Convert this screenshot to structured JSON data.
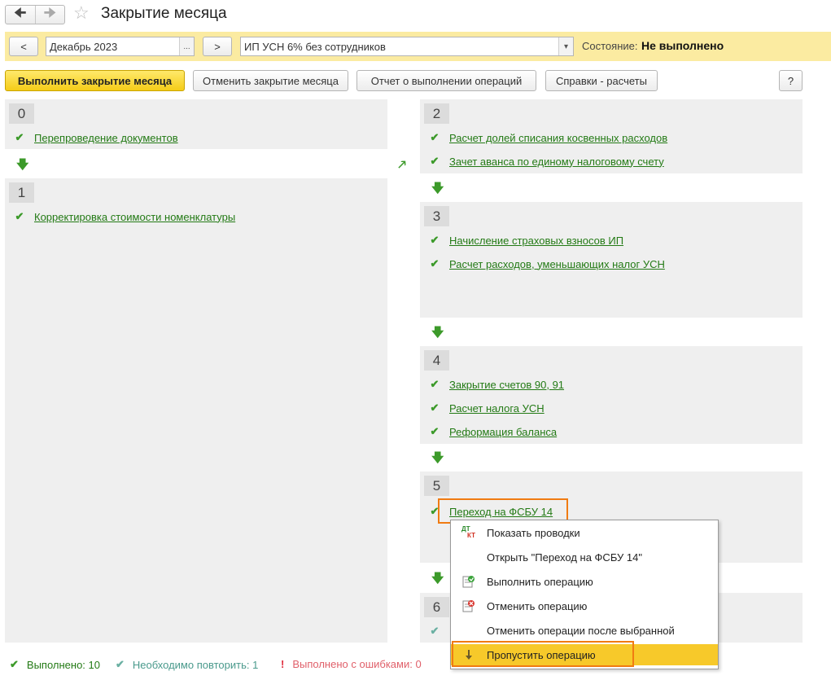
{
  "window": {
    "title": "Закрытие месяца"
  },
  "period": {
    "prev_label": "<",
    "value": "Декабрь 2023",
    "select_label": "...",
    "next_label": ">"
  },
  "organization": {
    "value": "ИП УСН 6% без сотрудников",
    "dropdown_glyph": "▾"
  },
  "state": {
    "label": "Состояние:",
    "value": "Не выполнено"
  },
  "toolbar": {
    "execute": "Выполнить закрытие месяца",
    "cancel": "Отменить закрытие месяца",
    "report": "Отчет о выполнении операций",
    "calculations": "Справки - расчеты",
    "help": "?"
  },
  "stages": [
    {
      "number": "0",
      "operations": [
        "Перепроведение документов"
      ]
    },
    {
      "number": "1",
      "operations": [
        "Корректировка стоимости номенклатуры"
      ]
    },
    {
      "number": "2",
      "operations": [
        "Расчет долей списания косвенных расходов",
        "Зачет аванса по единому налоговому счету"
      ]
    },
    {
      "number": "3",
      "operations": [
        "Начисление страховых взносов ИП",
        "Расчет расходов, уменьшающих налог УСН"
      ]
    },
    {
      "number": "4",
      "operations": [
        "Закрытие счетов 90, 91",
        "Расчет налога УСН",
        "Реформация баланса"
      ]
    },
    {
      "number": "5",
      "operations": [
        "Переход на ФСБУ 14"
      ]
    },
    {
      "number": "6",
      "operations": []
    }
  ],
  "context_menu": {
    "items": [
      {
        "label": "Показать проводки",
        "icon": "dt-kt-icon"
      },
      {
        "label": "Открыть \"Переход на ФСБУ 14\"",
        "icon": ""
      },
      {
        "label": "Выполнить операцию",
        "icon": "execute-operation-icon"
      },
      {
        "label": "Отменить операцию",
        "icon": "cancel-operation-icon"
      },
      {
        "label": "Отменить операции после выбранной",
        "icon": ""
      },
      {
        "label": "Пропустить операцию",
        "icon": "skip-arrow-icon"
      }
    ],
    "selected_index": 5,
    "dt_label": "ДТ",
    "kt_label": "КТ"
  },
  "status_bar": {
    "done": "Выполнено: 10",
    "repeat": "Необходимо повторить: 1",
    "errors": "Выполнено с ошибками: 0"
  },
  "colors": {
    "accent_yellow": "#f5cc18",
    "period_bar": "#fbeba1",
    "link_green": "#237a15",
    "highlight_orange": "#f07b12"
  }
}
